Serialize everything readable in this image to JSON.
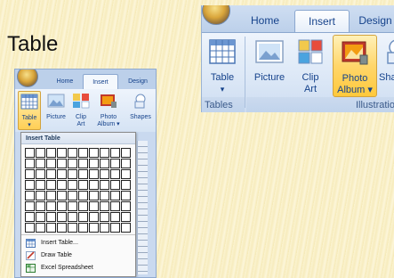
{
  "slide": {
    "title": "Table"
  },
  "ribbon_large": {
    "tabs": [
      "Home",
      "Insert",
      "Design"
    ],
    "active_tab": "Insert",
    "buttons": {
      "table": {
        "line1": "Table",
        "line2": "▾"
      },
      "picture": {
        "line1": "Picture",
        "line2": ""
      },
      "clip_art": {
        "line1": "Clip",
        "line2": "Art"
      },
      "photo_album": {
        "line1": "Photo",
        "line2": "Album ▾"
      },
      "shapes": {
        "line1": "Sha",
        "line2": ""
      }
    },
    "groups": {
      "tables": "Tables",
      "illustrations": "Illustratio"
    }
  },
  "ribbon_small": {
    "tabs": [
      "Home",
      "Insert",
      "Design"
    ],
    "buttons": {
      "table": {
        "line1": "Table",
        "line2": "▾"
      },
      "picture": {
        "line1": "Picture",
        "line2": ""
      },
      "clip_art": {
        "line1": "Clip",
        "line2": "Art"
      },
      "photo_album": {
        "line1": "Photo",
        "line2": "Album ▾"
      },
      "shapes": {
        "line1": "Shapes",
        "line2": ""
      }
    }
  },
  "insert_table_menu": {
    "header": "Insert Table",
    "grid_columns": 10,
    "grid_rows": 8,
    "items": [
      "Insert Table...",
      "Draw Table",
      "Excel Spreadsheet"
    ]
  },
  "colors": {
    "ribbon_blue": "#dfe9f6",
    "ribbon_text": "#15428b",
    "selected_orange": "#ffd66b",
    "slide_background": "#f8efc6"
  }
}
